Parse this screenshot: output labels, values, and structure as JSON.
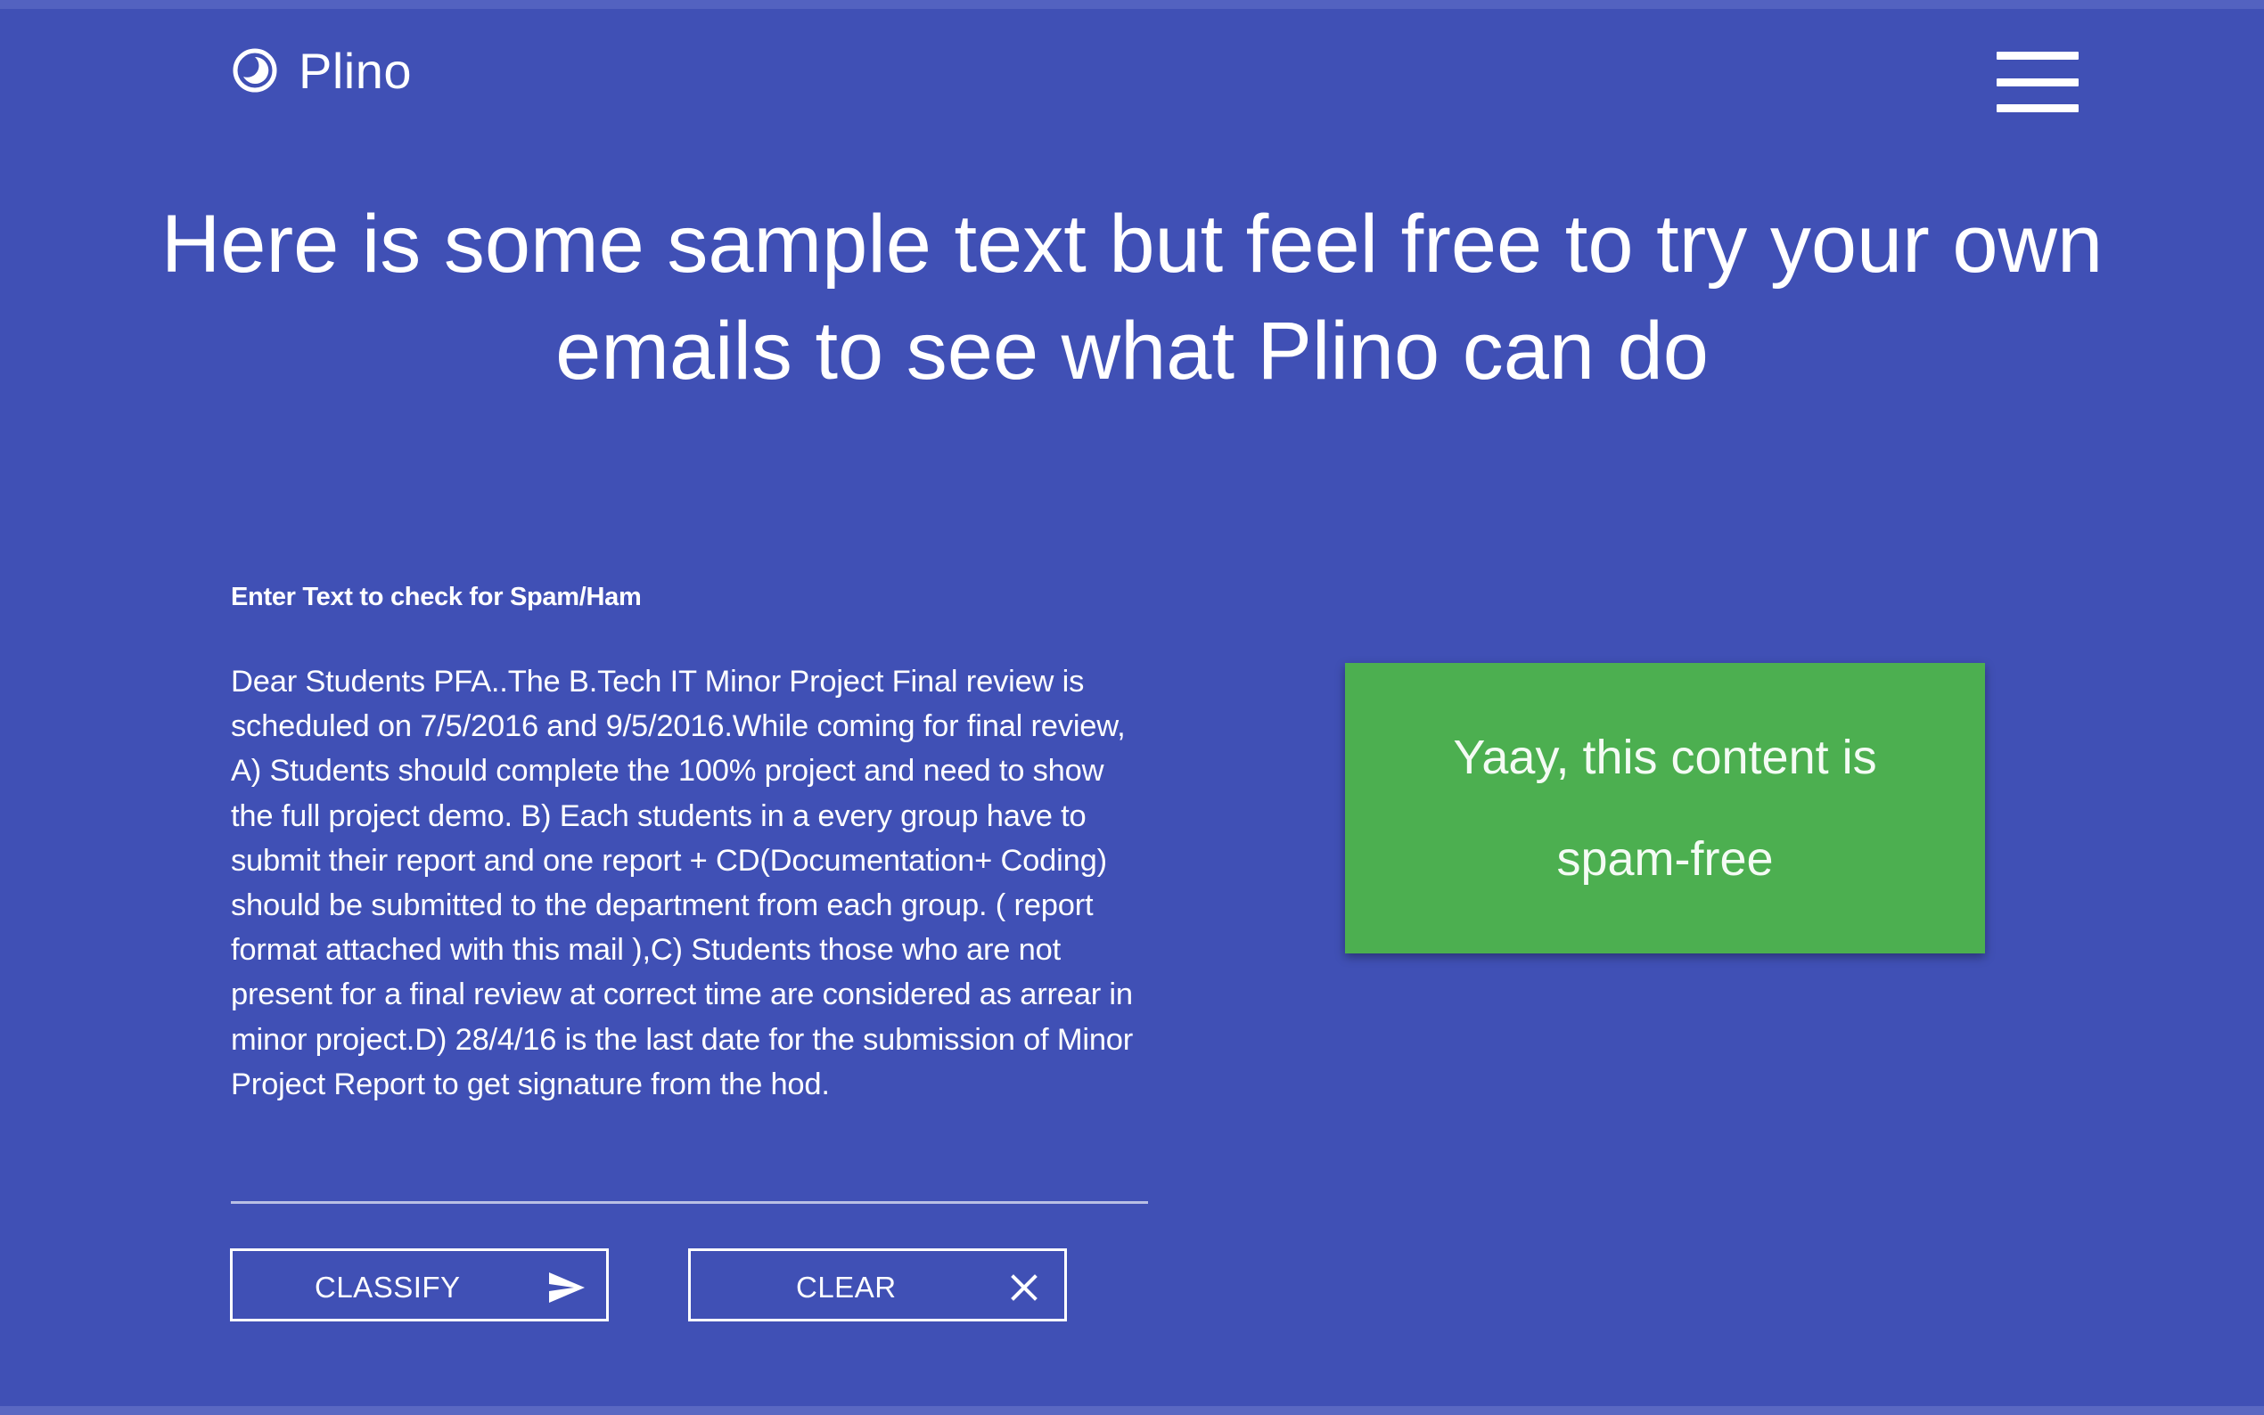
{
  "header": {
    "brand": "Plino",
    "logo_icon": "half-moon-circle-icon",
    "menu_icon": "hamburger-menu-icon"
  },
  "hero": {
    "title": "Here is some sample text but feel free to try your own emails to see what Plino can do"
  },
  "form": {
    "label": "Enter Text to check for Spam/Ham",
    "message": "Dear Students PFA..The B.Tech IT Minor Project Final review is scheduled on 7/5/2016 and 9/5/2016.While coming for final review, A) Students should complete the 100% project and need to show the full project demo. B) Each students in a every group have to submit their report and one report + CD(Documentation+ Coding) should be submitted to the department from each group. ( report format attached with this mail ),C) Students those who are not present for a final review at correct time are considered as arrear in minor project.D) 28/4/16 is the last date for the submission of Minor Project Report to get signature from the hod.",
    "classify_label": "CLASSIFY",
    "classify_icon": "send-icon",
    "clear_label": "CLEAR",
    "clear_icon": "close-icon"
  },
  "result": {
    "text": "Yaay, this content is spam-free",
    "color": "#4caf50"
  },
  "colors": {
    "background": "#4050b5",
    "text": "#ffffff",
    "success": "#4caf50"
  }
}
